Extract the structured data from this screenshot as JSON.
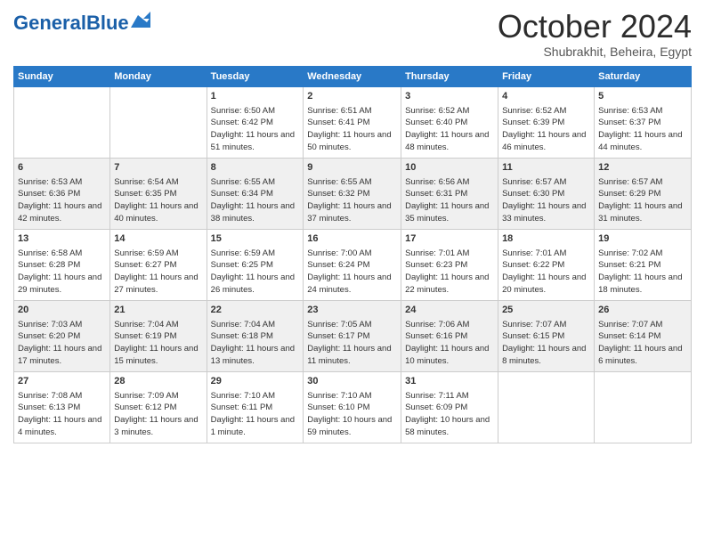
{
  "header": {
    "logo_general": "General",
    "logo_blue": "Blue",
    "month_title": "October 2024",
    "location": "Shubrakhit, Beheira, Egypt"
  },
  "days_of_week": [
    "Sunday",
    "Monday",
    "Tuesday",
    "Wednesday",
    "Thursday",
    "Friday",
    "Saturday"
  ],
  "weeks": [
    [
      {
        "day": "",
        "sunrise": "",
        "sunset": "",
        "daylight": ""
      },
      {
        "day": "",
        "sunrise": "",
        "sunset": "",
        "daylight": ""
      },
      {
        "day": "1",
        "sunrise": "Sunrise: 6:50 AM",
        "sunset": "Sunset: 6:42 PM",
        "daylight": "Daylight: 11 hours and 51 minutes."
      },
      {
        "day": "2",
        "sunrise": "Sunrise: 6:51 AM",
        "sunset": "Sunset: 6:41 PM",
        "daylight": "Daylight: 11 hours and 50 minutes."
      },
      {
        "day": "3",
        "sunrise": "Sunrise: 6:52 AM",
        "sunset": "Sunset: 6:40 PM",
        "daylight": "Daylight: 11 hours and 48 minutes."
      },
      {
        "day": "4",
        "sunrise": "Sunrise: 6:52 AM",
        "sunset": "Sunset: 6:39 PM",
        "daylight": "Daylight: 11 hours and 46 minutes."
      },
      {
        "day": "5",
        "sunrise": "Sunrise: 6:53 AM",
        "sunset": "Sunset: 6:37 PM",
        "daylight": "Daylight: 11 hours and 44 minutes."
      }
    ],
    [
      {
        "day": "6",
        "sunrise": "Sunrise: 6:53 AM",
        "sunset": "Sunset: 6:36 PM",
        "daylight": "Daylight: 11 hours and 42 minutes."
      },
      {
        "day": "7",
        "sunrise": "Sunrise: 6:54 AM",
        "sunset": "Sunset: 6:35 PM",
        "daylight": "Daylight: 11 hours and 40 minutes."
      },
      {
        "day": "8",
        "sunrise": "Sunrise: 6:55 AM",
        "sunset": "Sunset: 6:34 PM",
        "daylight": "Daylight: 11 hours and 38 minutes."
      },
      {
        "day": "9",
        "sunrise": "Sunrise: 6:55 AM",
        "sunset": "Sunset: 6:32 PM",
        "daylight": "Daylight: 11 hours and 37 minutes."
      },
      {
        "day": "10",
        "sunrise": "Sunrise: 6:56 AM",
        "sunset": "Sunset: 6:31 PM",
        "daylight": "Daylight: 11 hours and 35 minutes."
      },
      {
        "day": "11",
        "sunrise": "Sunrise: 6:57 AM",
        "sunset": "Sunset: 6:30 PM",
        "daylight": "Daylight: 11 hours and 33 minutes."
      },
      {
        "day": "12",
        "sunrise": "Sunrise: 6:57 AM",
        "sunset": "Sunset: 6:29 PM",
        "daylight": "Daylight: 11 hours and 31 minutes."
      }
    ],
    [
      {
        "day": "13",
        "sunrise": "Sunrise: 6:58 AM",
        "sunset": "Sunset: 6:28 PM",
        "daylight": "Daylight: 11 hours and 29 minutes."
      },
      {
        "day": "14",
        "sunrise": "Sunrise: 6:59 AM",
        "sunset": "Sunset: 6:27 PM",
        "daylight": "Daylight: 11 hours and 27 minutes."
      },
      {
        "day": "15",
        "sunrise": "Sunrise: 6:59 AM",
        "sunset": "Sunset: 6:25 PM",
        "daylight": "Daylight: 11 hours and 26 minutes."
      },
      {
        "day": "16",
        "sunrise": "Sunrise: 7:00 AM",
        "sunset": "Sunset: 6:24 PM",
        "daylight": "Daylight: 11 hours and 24 minutes."
      },
      {
        "day": "17",
        "sunrise": "Sunrise: 7:01 AM",
        "sunset": "Sunset: 6:23 PM",
        "daylight": "Daylight: 11 hours and 22 minutes."
      },
      {
        "day": "18",
        "sunrise": "Sunrise: 7:01 AM",
        "sunset": "Sunset: 6:22 PM",
        "daylight": "Daylight: 11 hours and 20 minutes."
      },
      {
        "day": "19",
        "sunrise": "Sunrise: 7:02 AM",
        "sunset": "Sunset: 6:21 PM",
        "daylight": "Daylight: 11 hours and 18 minutes."
      }
    ],
    [
      {
        "day": "20",
        "sunrise": "Sunrise: 7:03 AM",
        "sunset": "Sunset: 6:20 PM",
        "daylight": "Daylight: 11 hours and 17 minutes."
      },
      {
        "day": "21",
        "sunrise": "Sunrise: 7:04 AM",
        "sunset": "Sunset: 6:19 PM",
        "daylight": "Daylight: 11 hours and 15 minutes."
      },
      {
        "day": "22",
        "sunrise": "Sunrise: 7:04 AM",
        "sunset": "Sunset: 6:18 PM",
        "daylight": "Daylight: 11 hours and 13 minutes."
      },
      {
        "day": "23",
        "sunrise": "Sunrise: 7:05 AM",
        "sunset": "Sunset: 6:17 PM",
        "daylight": "Daylight: 11 hours and 11 minutes."
      },
      {
        "day": "24",
        "sunrise": "Sunrise: 7:06 AM",
        "sunset": "Sunset: 6:16 PM",
        "daylight": "Daylight: 11 hours and 10 minutes."
      },
      {
        "day": "25",
        "sunrise": "Sunrise: 7:07 AM",
        "sunset": "Sunset: 6:15 PM",
        "daylight": "Daylight: 11 hours and 8 minutes."
      },
      {
        "day": "26",
        "sunrise": "Sunrise: 7:07 AM",
        "sunset": "Sunset: 6:14 PM",
        "daylight": "Daylight: 11 hours and 6 minutes."
      }
    ],
    [
      {
        "day": "27",
        "sunrise": "Sunrise: 7:08 AM",
        "sunset": "Sunset: 6:13 PM",
        "daylight": "Daylight: 11 hours and 4 minutes."
      },
      {
        "day": "28",
        "sunrise": "Sunrise: 7:09 AM",
        "sunset": "Sunset: 6:12 PM",
        "daylight": "Daylight: 11 hours and 3 minutes."
      },
      {
        "day": "29",
        "sunrise": "Sunrise: 7:10 AM",
        "sunset": "Sunset: 6:11 PM",
        "daylight": "Daylight: 11 hours and 1 minute."
      },
      {
        "day": "30",
        "sunrise": "Sunrise: 7:10 AM",
        "sunset": "Sunset: 6:10 PM",
        "daylight": "Daylight: 10 hours and 59 minutes."
      },
      {
        "day": "31",
        "sunrise": "Sunrise: 7:11 AM",
        "sunset": "Sunset: 6:09 PM",
        "daylight": "Daylight: 10 hours and 58 minutes."
      },
      {
        "day": "",
        "sunrise": "",
        "sunset": "",
        "daylight": ""
      },
      {
        "day": "",
        "sunrise": "",
        "sunset": "",
        "daylight": ""
      }
    ]
  ]
}
